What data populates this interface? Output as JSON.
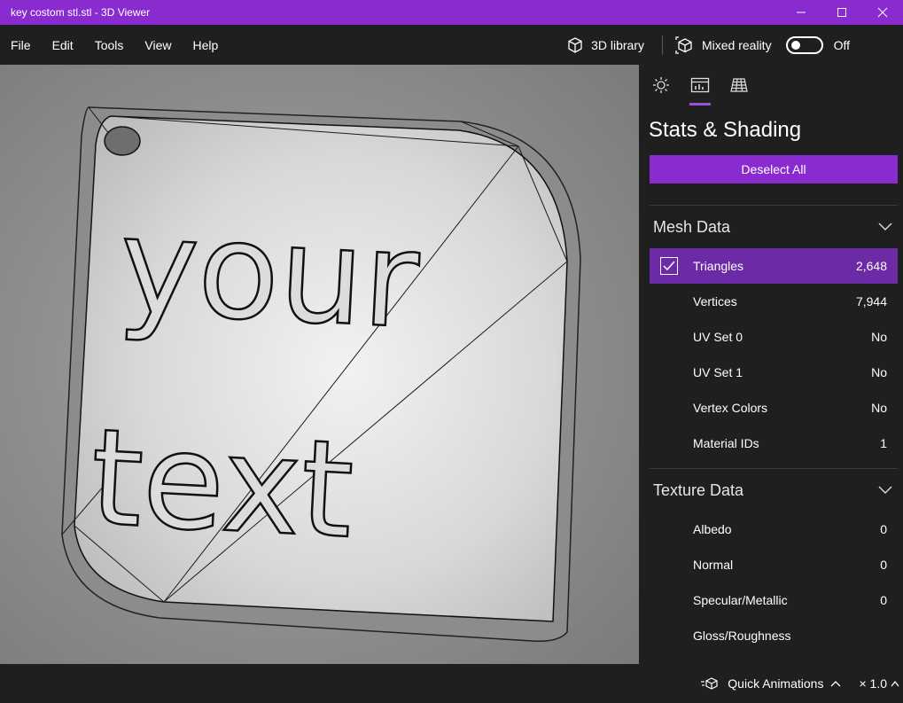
{
  "window": {
    "title": "key costom stl.stl - 3D Viewer"
  },
  "menu": {
    "items": [
      "File",
      "Edit",
      "Tools",
      "View",
      "Help"
    ]
  },
  "toolbar": {
    "library_label": "3D library",
    "mixed_reality_label": "Mixed reality",
    "toggle_state": "Off"
  },
  "model": {
    "line1": "your",
    "line2": "text"
  },
  "panel": {
    "heading": "Stats & Shading",
    "deselect_label": "Deselect All",
    "mesh_section": "Mesh Data",
    "mesh_rows": [
      {
        "label": "Triangles",
        "value": "2,648"
      },
      {
        "label": "Vertices",
        "value": "7,944"
      },
      {
        "label": "UV Set 0",
        "value": "No"
      },
      {
        "label": "UV Set 1",
        "value": "No"
      },
      {
        "label": "Vertex Colors",
        "value": "No"
      },
      {
        "label": "Material IDs",
        "value": "1"
      }
    ],
    "texture_section": "Texture Data",
    "texture_rows": [
      {
        "label": "Albedo",
        "value": "0"
      },
      {
        "label": "Normal",
        "value": "0"
      },
      {
        "label": "Specular/Metallic",
        "value": "0"
      },
      {
        "label": "Gloss/Roughness",
        "value": ""
      }
    ]
  },
  "status": {
    "quick_animations_label": "Quick Animations",
    "zoom_label": "× 1.0"
  },
  "colors": {
    "accent": "#8a2bd0",
    "selected_row": "#6d2aa6",
    "background": "#1f1f1f",
    "viewport": "#9a9a9a"
  }
}
